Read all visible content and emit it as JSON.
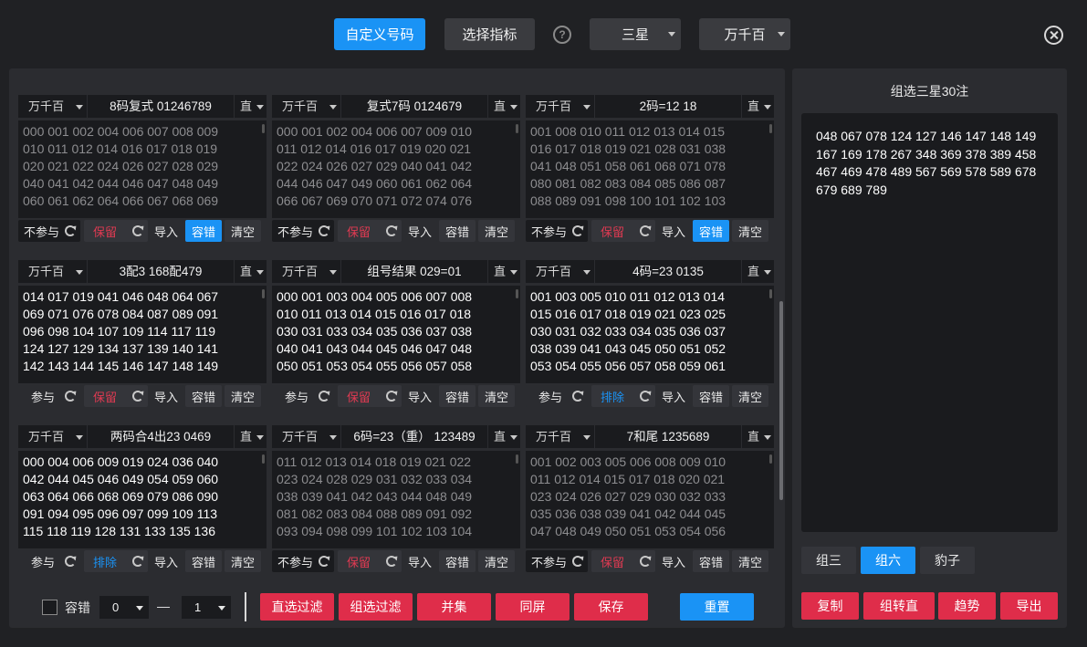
{
  "toolbar": {
    "custom_code": "自定义号码",
    "choose_indicator": "选择指标",
    "help": "?",
    "star_select": "三星",
    "position_select": "万千百"
  },
  "cards": [
    {
      "pos": "万千百",
      "title": "8码复式 01246789",
      "mode": "直",
      "nums": "000 001 002 004 006 007 008 009\n010 011 012 014 016 017 018 019\n020 021 022 024 026 027 028 029\n040 041 042 044 046 047 048 049\n060 061 062 064 066 067 068 069",
      "toggle": "不参与",
      "keep": "保留",
      "import": "导入",
      "tolerance": "容错",
      "clear": "清空"
    },
    {
      "pos": "万千百",
      "title": "复式7码 0124679",
      "mode": "直",
      "nums": "000 001 002 004 006 007 009 010\n011 012 014 016 017 019 020 021\n022 024 026 027 029 040 041 042\n044 046 047 049 060 061 062 064\n066 067 069 070 071 072 074 076",
      "toggle": "不参与",
      "keep": "保留",
      "import": "导入",
      "tolerance": "容错",
      "clear": "清空"
    },
    {
      "pos": "万千百",
      "title": "2码=12 18",
      "mode": "直",
      "nums": "001 008 010 011 012 013 014 015\n016 017 018 019 021 028 031 038\n041 048 051 058 061 068 071 078\n080 081 082 083 084 085 086 087\n088 089 091 098 100 101 102 103",
      "toggle": "不参与",
      "keep": "保留",
      "import": "导入",
      "tolerance": "容错",
      "clear": "清空"
    },
    {
      "pos": "万千百",
      "title": "3配3 168配479",
      "mode": "直",
      "nums": "014 017 019 041 046 048 064 067\n069 071 076 078 084 087 089 091\n096 098 104 107 109 114 117 119\n124 127 129 134 137 139 140 141\n142 143 144 145 146 147 148 149",
      "toggle": "参与",
      "keep": "保留",
      "import": "导入",
      "tolerance": "容错",
      "clear": "清空"
    },
    {
      "pos": "万千百",
      "title": "组号结果 029=01",
      "mode": "直",
      "nums": "000 001 003 004 005 006 007 008\n010 011 013 014 015 016 017 018\n030 031 033 034 035 036 037 038\n040 041 043 044 045 046 047 048\n050 051 053 054 055 056 057 058",
      "toggle": "参与",
      "keep": "保留",
      "import": "导入",
      "tolerance": "容错",
      "clear": "清空"
    },
    {
      "pos": "万千百",
      "title": "4码=23 0135",
      "mode": "直",
      "nums": "001 003 005 010 011 012 013 014\n015 016 017 018 019 021 023 025\n030 031 032 033 034 035 036 037\n038 039 041 043 045 050 051 052\n053 054 055 056 057 058 059 061",
      "toggle": "参与",
      "keep": "排除",
      "import": "导入",
      "tolerance": "容错",
      "clear": "清空"
    },
    {
      "pos": "万千百",
      "title": "两码合4出23 0469",
      "mode": "直",
      "nums": "000 004 006 009 019 024 036 040\n042 044 045 046 049 054 059 060\n063 064 066 068 069 079 086 090\n091 094 095 096 097 099 109 113\n115 118 119 128 131 133 135 136",
      "toggle": "参与",
      "keep": "排除",
      "import": "导入",
      "tolerance": "容错",
      "clear": "清空"
    },
    {
      "pos": "万千百",
      "title": "6码=23（重）  123489",
      "mode": "直",
      "nums": "011 012 013 014 018 019 021 022\n023 024 028 029 031 032 033 034\n038 039 041 042 043 044 048 049\n081 082 083 084 088 089 091 092\n093 094 098 099 101 102 103 104",
      "toggle": "不参与",
      "keep": "保留",
      "import": "导入",
      "tolerance": "容错",
      "clear": "清空"
    },
    {
      "pos": "万千百",
      "title": "7和尾 1235689",
      "mode": "直",
      "nums": "001 002 003 005 006 008 009 010\n011 012 014 015 017 018 020 021\n023 024 026 027 029 030 032 033\n035 036 038 039 041 042 044 045\n047 048 049 050 051 053 054 056",
      "toggle": "不参与",
      "keep": "保留",
      "import": "导入",
      "tolerance": "容错",
      "clear": "清空"
    }
  ],
  "bottom": {
    "tolerance_label": "容错",
    "min_value": "0",
    "dash": "—",
    "max_value": "1",
    "direct_filter": "直选过滤",
    "group_filter": "组选过滤",
    "union": "并集",
    "same_screen": "同屏",
    "save": "保存",
    "reset": "重置"
  },
  "result": {
    "title": "组选三星30注",
    "nums": "048 067 078 124 127 146 147 148 149\n167 169 178 267 348 369 378 389 458\n467 469 478 489 567 569 578 589 678\n679 689 789",
    "tabs": [
      "组三",
      "组六",
      "豹子"
    ],
    "actions": [
      "复制",
      "组转直",
      "趋势",
      "导出"
    ]
  },
  "colors": {
    "accent": "#1a93f5",
    "danger": "#df2d4a"
  }
}
